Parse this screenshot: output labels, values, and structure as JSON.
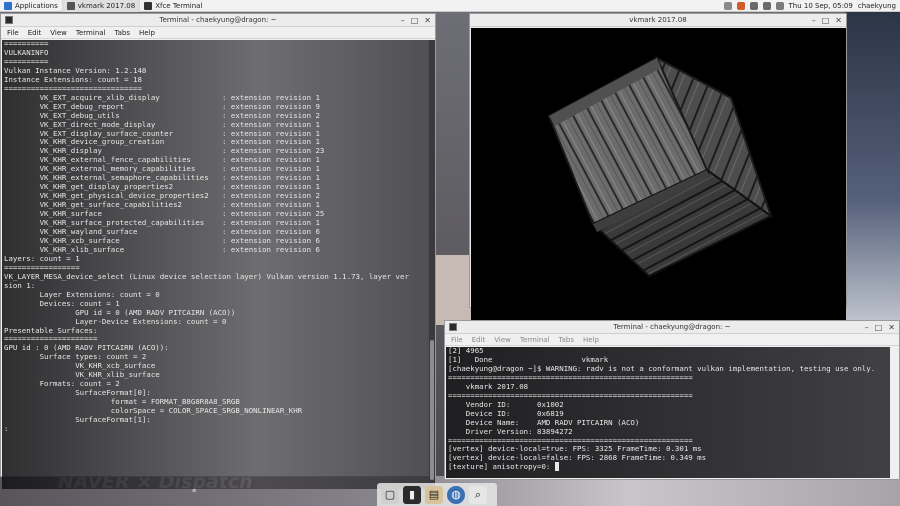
{
  "panel": {
    "apps_label": "Applications",
    "tasks": [
      {
        "label": "vkmark 2017.08"
      },
      {
        "label": "Xfce Terminal"
      }
    ],
    "clock": "Thu 10 Sep, 05:09",
    "user": "chaekyung"
  },
  "term1": {
    "title": "Terminal - chaekyung@dragon: ~",
    "menu": [
      "File",
      "Edit",
      "View",
      "Terminal",
      "Tabs",
      "Help"
    ],
    "lines": [
      "==========",
      "VULKANINFO",
      "==========",
      "",
      "Vulkan Instance Version: 1.2.148",
      "",
      "",
      "Instance Extensions: count = 18",
      "===============================",
      "        VK_EXT_acquire_xlib_display              : extension revision 1",
      "        VK_EXT_debug_report                      : extension revision 9",
      "        VK_EXT_debug_utils                       : extension revision 2",
      "        VK_EXT_direct_mode_display               : extension revision 1",
      "        VK_EXT_display_surface_counter           : extension revision 1",
      "        VK_KHR_device_group_creation             : extension revision 1",
      "        VK_KHR_display                           : extension revision 23",
      "        VK_KHR_external_fence_capabilities       : extension revision 1",
      "        VK_KHR_external_memory_capabilities      : extension revision 1",
      "        VK_KHR_external_semaphore_capabilities   : extension revision 1",
      "        VK_KHR_get_display_properties2           : extension revision 1",
      "        VK_KHR_get_physical_device_properties2   : extension revision 2",
      "        VK_KHR_get_surface_capabilities2         : extension revision 1",
      "        VK_KHR_surface                           : extension revision 25",
      "        VK_KHR_surface_protected_capabilities    : extension revision 1",
      "        VK_KHR_wayland_surface                   : extension revision 6",
      "        VK_KHR_xcb_surface                       : extension revision 6",
      "        VK_KHR_xlib_surface                      : extension revision 6",
      "",
      "Layers: count = 1",
      "=================",
      "VK_LAYER_MESA_device_select (Linux device selection layer) Vulkan version 1.1.73, layer ver",
      "sion 1:",
      "        Layer Extensions: count = 0",
      "        Devices: count = 1",
      "                GPU id = 0 (AMD RADV PITCAIRN (ACO))",
      "                Layer-Device Extensions: count = 0",
      "",
      "Presentable Surfaces:",
      "=====================",
      "GPU id : 0 (AMD RADV PITCAIRN (ACO)):",
      "        Surface types: count = 2",
      "                VK_KHR_xcb_surface",
      "                VK_KHR_xlib_surface",
      "        Formats: count = 2",
      "                SurfaceFormat[0]:",
      "                        format = FORMAT_B8G8R8A8_SRGB",
      "                        colorSpace = COLOR_SPACE_SRGB_NONLINEAR_KHR",
      "                SurfaceFormat[1]:",
      ":"
    ]
  },
  "vkmark": {
    "title": "vkmark 2017.08"
  },
  "term2": {
    "title": "Terminal - chaekyung@dragon: ~",
    "menu": [
      "File",
      "Edit",
      "View",
      "Terminal",
      "Tabs",
      "Help"
    ],
    "lines": [
      "[2] 4965",
      "[1]   Done                    vkmark",
      "[chaekyung@dragon ~]$ WARNING: radv is not a conformant vulkan implementation, testing use only.",
      "=======================================================",
      "    vkmark 2017.08",
      "=======================================================",
      "    Vendor ID:      0x1002",
      "    Device ID:      0x6819",
      "    Device Name:    AMD RADV PITCAIRN (ACO)",
      "    Driver Version: 83894272",
      "=======================================================",
      "[vertex] device-local=true: FPS: 3325 FrameTime: 0.301 ms",
      "[vertex] device-local=false: FPS: 2868 FrameTime: 0.349 ms",
      "[texture] anisotropy=0: "
    ]
  },
  "wallpaper": {
    "watermark": "NAVER × Dispatch"
  },
  "colors": {
    "terminal_text": "#e8e8e8",
    "panel_bg": "#f2f2f2"
  }
}
